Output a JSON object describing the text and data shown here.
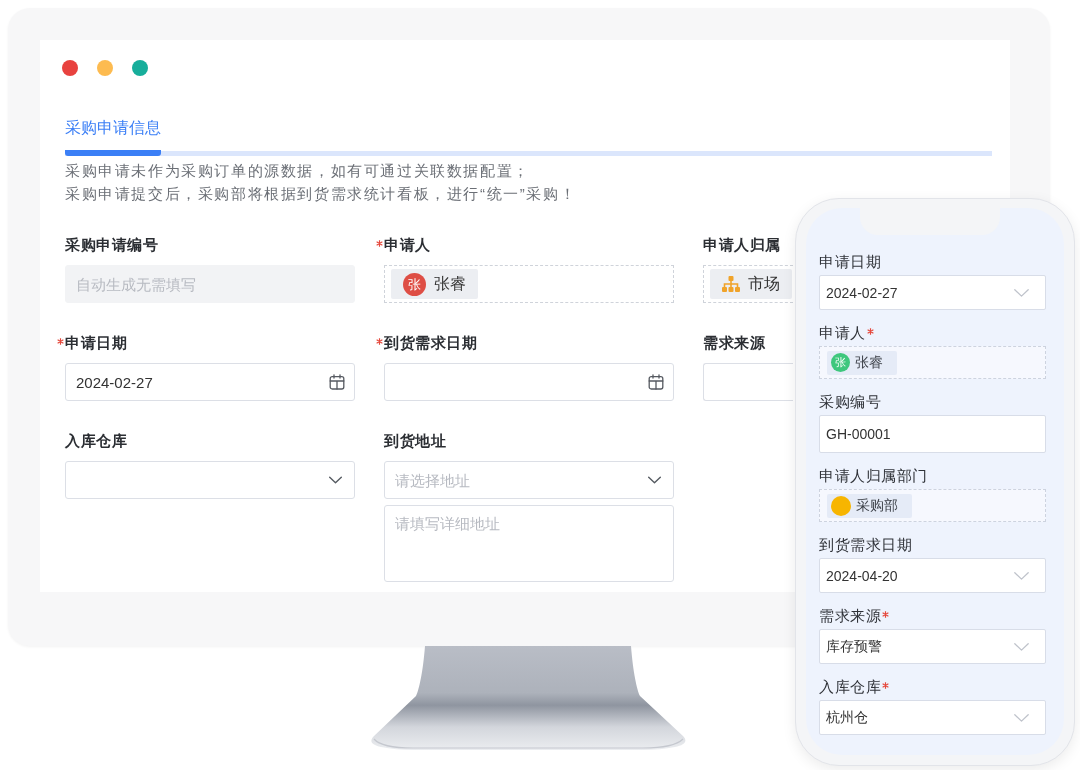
{
  "desktop": {
    "window_controls": [
      {
        "color": "#e8423f"
      },
      {
        "color": "#fdbb50"
      },
      {
        "color": "#17ae9b"
      }
    ],
    "tabs": [
      {
        "label": "采购申请信息",
        "selected": true
      }
    ],
    "notes": [
      "采购申请未作为采购订单的源数据，如有可通过关联数据配置；",
      "采购申请提交后，采购部将根据到货需求统计看板，进行“统一”采购！"
    ],
    "fields": [
      {
        "label": "采购申请编号",
        "required": false,
        "disabled": true,
        "kind": "text",
        "placeholder": "自动生成无需填写"
      },
      {
        "label": "申请人",
        "required": true,
        "disabled": false,
        "kind": "member",
        "avatar": "张",
        "name": "张睿"
      },
      {
        "label": "申请人归属",
        "required": false,
        "disabled": false,
        "kind": "department",
        "name": "市场"
      },
      {
        "label": "申请日期",
        "required": true,
        "disabled": false,
        "kind": "date",
        "value": "2024-02-27"
      },
      {
        "label": "到货需求日期",
        "required": true,
        "disabled": false,
        "kind": "date"
      },
      {
        "label": "需求来源",
        "required": false,
        "disabled": false,
        "kind": "text"
      },
      {
        "label": "入库仓库",
        "required": false,
        "disabled": false,
        "kind": "select"
      },
      {
        "label": "到货地址",
        "required": false,
        "disabled": false,
        "kind": "address",
        "placeholder": "请选择地址",
        "detail_placeholder": "请填写详细地址"
      }
    ]
  },
  "phone": {
    "fields": [
      {
        "label": "申请日期",
        "required": false,
        "kind": "select",
        "value": "2024-02-27"
      },
      {
        "label": "申请人",
        "required": true,
        "kind": "member",
        "avatar": "张",
        "name": "张睿"
      },
      {
        "label": "采购编号",
        "required": false,
        "kind": "text",
        "value": "GH-00001"
      },
      {
        "label": "申请人归属部门",
        "required": false,
        "kind": "department",
        "name": "采购部"
      },
      {
        "label": "到货需求日期",
        "required": false,
        "kind": "select",
        "value": "2024-04-20"
      },
      {
        "label": "需求来源",
        "required": true,
        "kind": "select",
        "value": "库存预警"
      },
      {
        "label": "入库仓库",
        "required": true,
        "kind": "select",
        "value": "杭州仓"
      }
    ]
  }
}
